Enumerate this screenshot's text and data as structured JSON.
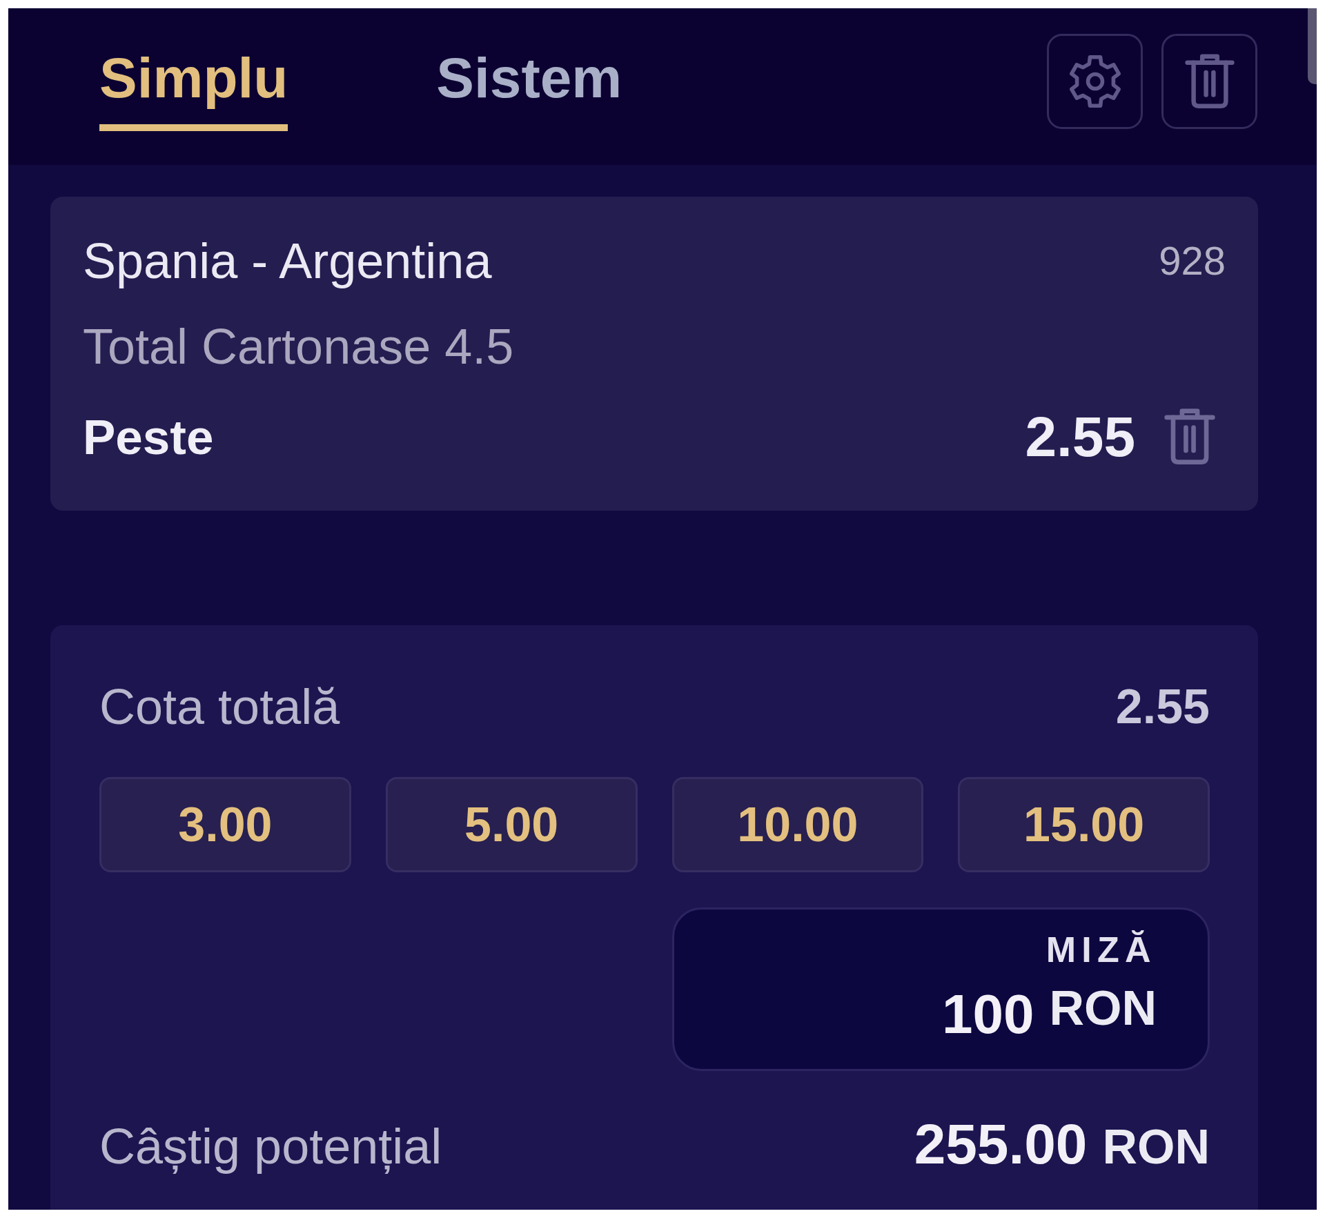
{
  "tabs": [
    {
      "label": "Simplu",
      "selected": true
    },
    {
      "label": "Sistem",
      "selected": false
    }
  ],
  "selections": [
    {
      "match": "Spania - Argentina",
      "code": "928",
      "market": "Total Cartonase 4.5",
      "outcome": "Peste",
      "odds": "2.55"
    }
  ],
  "summary": {
    "total_odds_label": "Cota totală",
    "total_odds": "2.55",
    "quick_stakes": [
      "3.00",
      "5.00",
      "10.00",
      "15.00"
    ],
    "stake": {
      "label": "MIZĂ",
      "value": "100",
      "currency": "RON"
    },
    "potential_win_label": "Câștig potențial",
    "potential_win": "255.00",
    "potential_win_currency": "RON"
  }
}
